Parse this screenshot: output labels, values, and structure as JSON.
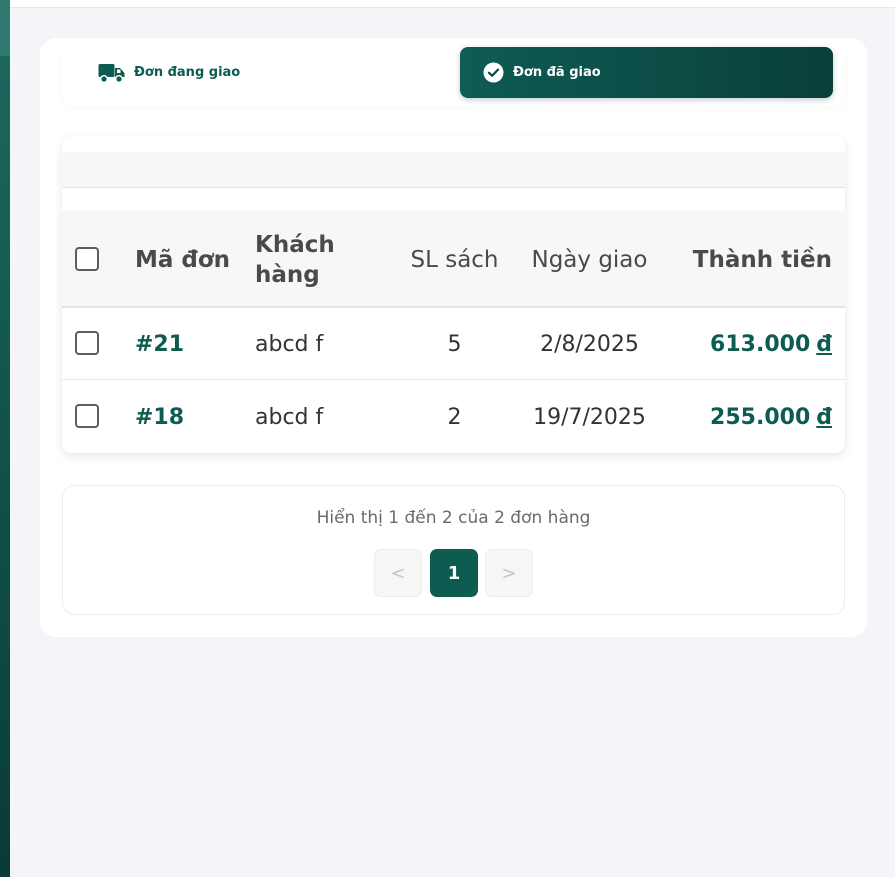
{
  "tabs": {
    "shipping": {
      "label": "Đơn đang giao",
      "icon": "truck-icon"
    },
    "delivered": {
      "label": "Đơn đã giao",
      "icon": "check-circle-icon",
      "active": true
    }
  },
  "table": {
    "columns": {
      "code": "Mã đơn",
      "customer_line1": "Khách",
      "customer_line2": "hàng",
      "qty": "SL sách",
      "date": "Ngày giao",
      "total": "Thành tiền"
    },
    "rows": [
      {
        "code": "#21",
        "customer": "abcd f",
        "qty": "5",
        "date": "2/8/2025",
        "total": "613.000",
        "currency": "đ"
      },
      {
        "code": "#18",
        "customer": "abcd f",
        "qty": "2",
        "date": "19/7/2025",
        "total": "255.000",
        "currency": "đ"
      }
    ]
  },
  "pagination": {
    "info": "Hiển thị 1 đến 2 của 2 đơn hàng",
    "prev": "<",
    "current": "1",
    "next": ">"
  },
  "colors": {
    "brand": "#0e5b52",
    "brand_dark": "#0a3f3a",
    "background": "#f4f5f9"
  }
}
